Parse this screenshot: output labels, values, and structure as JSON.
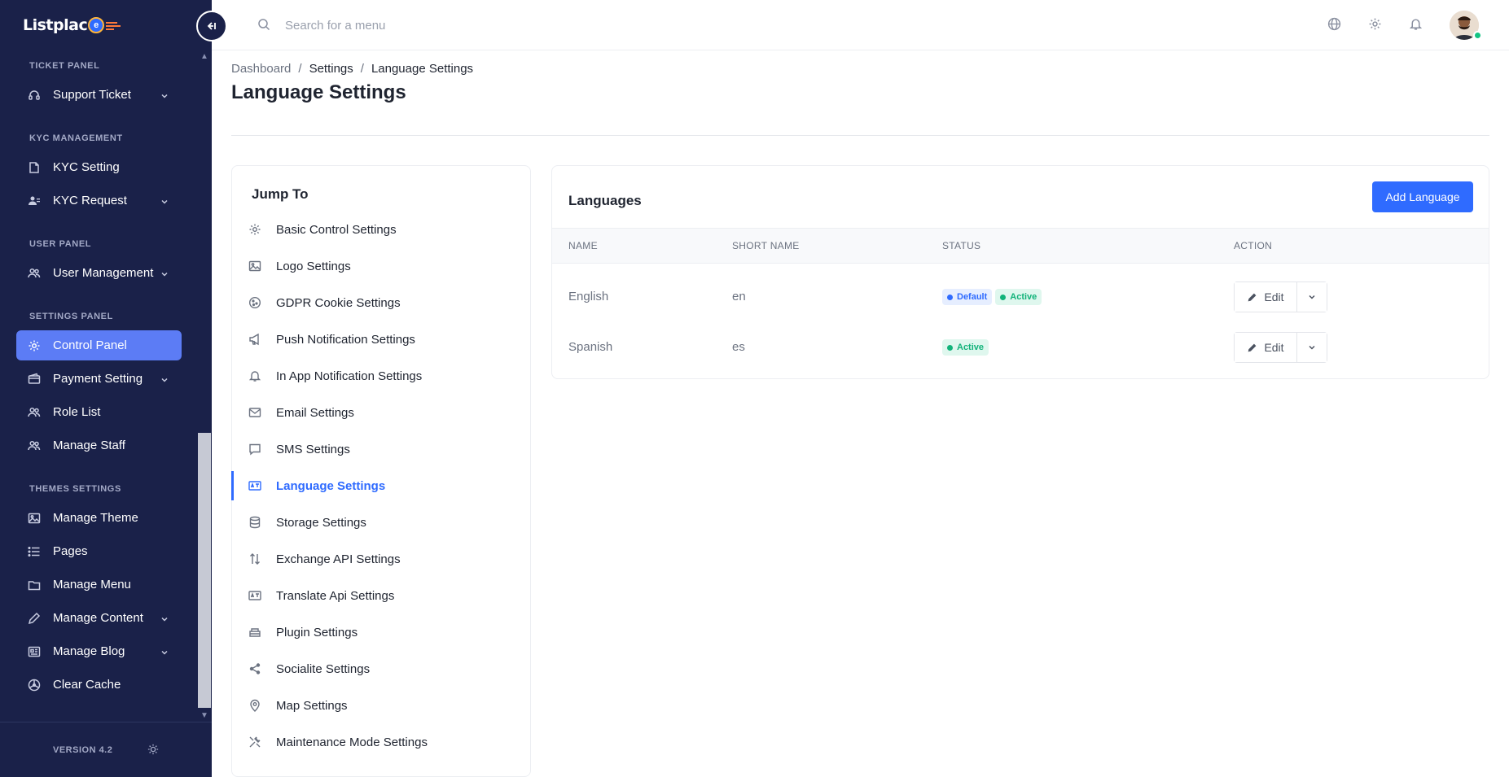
{
  "brand": {
    "logo_text": "Listplac",
    "logo_mark": "e"
  },
  "sidebar": {
    "sections": [
      {
        "label": "TICKET PANEL"
      },
      {
        "label": "KYC MANAGEMENT"
      },
      {
        "label": "USER PANEL"
      },
      {
        "label": "SETTINGS PANEL"
      },
      {
        "label": "THEMES SETTINGS"
      }
    ],
    "items": [
      {
        "label": "Support Ticket",
        "icon": "headset-icon",
        "has_submenu": true
      },
      {
        "label": "KYC Setting",
        "icon": "file-icon",
        "has_submenu": false
      },
      {
        "label": "KYC Request",
        "icon": "users-icon",
        "has_submenu": true
      },
      {
        "label": "User Management",
        "icon": "users-group-icon",
        "has_submenu": true
      },
      {
        "label": "Control Panel",
        "icon": "gear-icon",
        "has_submenu": false,
        "active": true
      },
      {
        "label": "Payment Setting",
        "icon": "wallet-icon",
        "has_submenu": true
      },
      {
        "label": "Role List",
        "icon": "users-group-icon",
        "has_submenu": false
      },
      {
        "label": "Manage Staff",
        "icon": "users-group-icon",
        "has_submenu": false
      },
      {
        "label": "Manage Theme",
        "icon": "image-icon",
        "has_submenu": false
      },
      {
        "label": "Pages",
        "icon": "list-icon",
        "has_submenu": false
      },
      {
        "label": "Manage Menu",
        "icon": "folder-icon",
        "has_submenu": false
      },
      {
        "label": "Manage Content",
        "icon": "pencil-icon",
        "has_submenu": true
      },
      {
        "label": "Manage Blog",
        "icon": "newspaper-icon",
        "has_submenu": true
      },
      {
        "label": "Clear Cache",
        "icon": "radiation-icon",
        "has_submenu": false
      }
    ],
    "version": "VERSION 4.2"
  },
  "header": {
    "search_placeholder": "Search for a menu"
  },
  "breadcrumb": {
    "root": "Dashboard",
    "separator": "/",
    "middle": "Settings",
    "current": "Language Settings"
  },
  "page_title": "Language Settings",
  "jump_to": {
    "title": "Jump To",
    "items": [
      {
        "label": "Basic Control Settings",
        "icon": "gear-icon"
      },
      {
        "label": "Logo Settings",
        "icon": "image-icon"
      },
      {
        "label": "GDPR Cookie Settings",
        "icon": "cookie-icon"
      },
      {
        "label": "Push Notification Settings",
        "icon": "megaphone-icon"
      },
      {
        "label": "In App Notification Settings",
        "icon": "bell-icon"
      },
      {
        "label": "Email Settings",
        "icon": "envelope-icon"
      },
      {
        "label": "SMS Settings",
        "icon": "chat-icon"
      },
      {
        "label": "Language Settings",
        "icon": "language-icon",
        "active": true
      },
      {
        "label": "Storage Settings",
        "icon": "database-icon"
      },
      {
        "label": "Exchange API Settings",
        "icon": "exchange-icon"
      },
      {
        "label": "Translate Api Settings",
        "icon": "translate-icon"
      },
      {
        "label": "Plugin Settings",
        "icon": "plugin-icon"
      },
      {
        "label": "Socialite Settings",
        "icon": "share-icon"
      },
      {
        "label": "Map Settings",
        "icon": "map-pin-icon"
      },
      {
        "label": "Maintenance Mode Settings",
        "icon": "tools-icon"
      }
    ]
  },
  "languages": {
    "title": "Languages",
    "add_button": "Add Language",
    "columns": [
      "NAME",
      "SHORT NAME",
      "STATUS",
      "ACTION"
    ],
    "rows": [
      {
        "name": "English",
        "short_name": "en",
        "badges": [
          "Default",
          "Active"
        ],
        "action": "Edit"
      },
      {
        "name": "Spanish",
        "short_name": "es",
        "badges": [
          "Active"
        ],
        "action": "Edit"
      }
    ]
  },
  "colors": {
    "sidebar_bg": "#1a2149",
    "accent": "#2f6bff",
    "active_item": "#5c7cf5",
    "success": "#12b37a"
  }
}
